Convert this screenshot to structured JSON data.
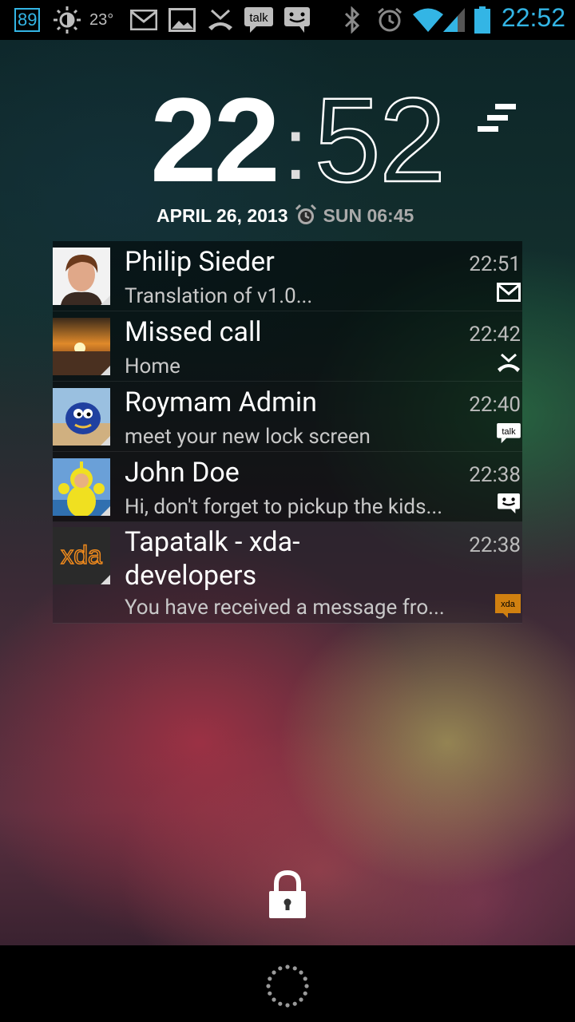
{
  "status_bar": {
    "badge": "89",
    "temperature": "23°",
    "time": "22:52",
    "icons": [
      "weather-icon",
      "gmail-icon",
      "gallery-icon",
      "missed-call-icon",
      "talk-icon",
      "messaging-icon",
      "bluetooth-icon",
      "alarm-icon",
      "wifi-icon",
      "signal-icon",
      "battery-icon"
    ],
    "talk_label": "talk"
  },
  "clock": {
    "hours": "22",
    "colon": ":",
    "minutes": "52",
    "date": "APRIL 26, 2013",
    "alarm": "SUN 06:45"
  },
  "notifications": [
    {
      "title": "Philip Sieder",
      "subtitle": "Translation of v1.0...",
      "time": "22:51",
      "icon": "gmail-icon"
    },
    {
      "title": "Missed call",
      "subtitle": "Home",
      "time": "22:42",
      "icon": "missed-call-icon"
    },
    {
      "title": "Roymam Admin",
      "subtitle": "meet your new lock screen",
      "time": "22:40",
      "icon": "talk-icon"
    },
    {
      "title": "John Doe",
      "subtitle": "Hi,  don't forget to pickup the kids...",
      "time": "22:38",
      "icon": "messaging-icon"
    },
    {
      "title": "Tapatalk - xda-developers",
      "subtitle": "You have received a message fro...",
      "time": "22:38",
      "icon": "xda-icon",
      "avatar_text": "xda",
      "icon_text": "xda"
    }
  ],
  "colors": {
    "accent": "#33b5e5",
    "xda_orange": "#f08a1c"
  }
}
